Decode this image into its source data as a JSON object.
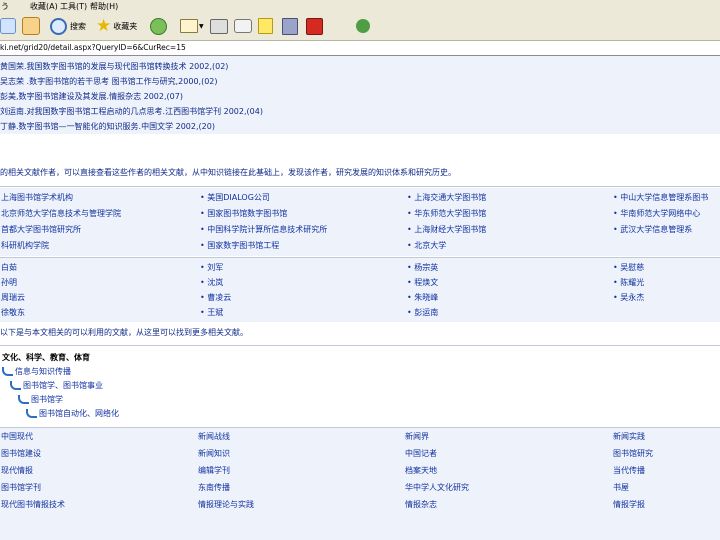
{
  "menubar": [
    "う",
    "收藏(A)",
    "工具(T)",
    "帮助(H)"
  ],
  "toolbar": {
    "search_label": "搜索",
    "favorites_label": "收藏夹"
  },
  "address": {
    "value": "ki.net/grid20/detail.aspx?QueryID=6&CurRec=15"
  },
  "references": [
    "黄国荣.我国数字图书馆的发展与现代图书馆转换技术 2002,(02)",
    "吴志荣 .数字图书馆的若干思考 图书馆工作与研究,2000,(02)",
    "彭美,数字图书馆建设及其发展.情报杂志 2002,(07)",
    "刘运南.对我国数字图书馆工程启动的几点思考.江西图书馆学刊 2002,(04)",
    "丁静.数字图书馆—一智能化的知识服务.中国文学 2002,(20)"
  ],
  "description": "的相关文献作者，可以直接查看这些作者的相关文献，从中知识链接在此基础上，发现该作者，研究发展的知识体系和研究历史。",
  "orgs": [
    [
      "上海图书馆学术机构",
      "• 美国DIALOG公司",
      "• 上海交通大学图书馆",
      "• 中山大学信息管理系图书"
    ],
    [
      "北京师范大学信息技术与管理学院",
      "• 国家图书馆数字图书馆",
      "• 华东师范大学图书馆",
      "• 华南师范大学网络中心"
    ],
    [
      "首都大学图书馆研究所",
      "• 中国科学院计算所信息技术研究所",
      "• 上海财经大学图书馆",
      "• 武汉大学信息管理系"
    ],
    [
      "科研机构学院",
      "• 国家数字图书馆工程",
      "• 北京大学",
      ""
    ]
  ],
  "authors": [
    [
      "白茹",
      "• 刘军",
      "• 杨宗英",
      "• 吴慰慈"
    ],
    [
      "孙明",
      "• 沈岚",
      "• 程焕文",
      "• 陈耀光"
    ],
    [
      "周瑞云",
      "• 曹凌云",
      "• 朱晓峰",
      "• 吴永杰"
    ],
    [
      "徐敬东",
      "• 王斌",
      "• 彭运南",
      ""
    ]
  ],
  "note": "以下是与本文相关的可以利用的文献，从这里可以找到更多相关文献。",
  "tree": [
    "文化、科学、教育、体育",
    "信息与知识传播",
    "图书馆学、图书馆事业",
    "图书馆学",
    "图书馆自动化、网络化"
  ],
  "journals": [
    [
      "中国现代",
      "新闻战线",
      "新闻界",
      "新闻实践"
    ],
    [
      "图书馆建设",
      "新闻知识",
      "中国记者",
      "图书馆研究"
    ],
    [
      "现代情报",
      "编辑学刊",
      "档案天地",
      "当代传播"
    ],
    [
      "图书馆学刊",
      "东南传播",
      "华中学人文化研究",
      "书屋"
    ],
    [
      "现代图书情报技术",
      "情报理论与实践",
      "情报杂志",
      "情报学报"
    ]
  ]
}
